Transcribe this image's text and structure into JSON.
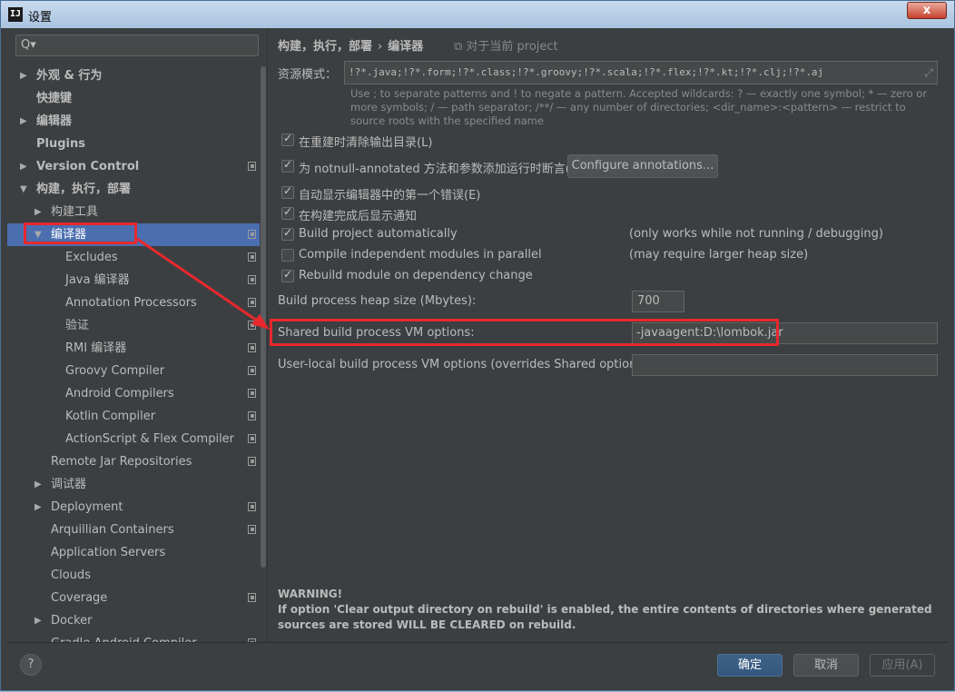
{
  "window": {
    "app_icon": "IJ",
    "title": "设置",
    "close_label": "x"
  },
  "search": {
    "placeholder": "Q▾"
  },
  "tree": [
    {
      "label": "外观 & 行为",
      "bold": true,
      "arrow": "right"
    },
    {
      "label": "快捷键",
      "bold": true
    },
    {
      "label": "编辑器",
      "bold": true,
      "arrow": "right"
    },
    {
      "label": "Plugins",
      "bold": true
    },
    {
      "label": "Version Control",
      "bold": true,
      "arrow": "right"
    },
    {
      "label": "构建，执行，部署",
      "bold": true,
      "arrow": "down"
    },
    {
      "label": "构建工具",
      "arrow": "right"
    },
    {
      "label": "编译器",
      "arrow": "down",
      "selected": true
    },
    {
      "label": "Excludes"
    },
    {
      "label": "Java 编译器"
    },
    {
      "label": "Annotation Processors"
    },
    {
      "label": "验证"
    },
    {
      "label": "RMI 编译器"
    },
    {
      "label": "Groovy Compiler"
    },
    {
      "label": "Android Compilers"
    },
    {
      "label": "Kotlin Compiler"
    },
    {
      "label": "ActionScript & Flex Compiler"
    },
    {
      "label": "Remote Jar Repositories"
    },
    {
      "label": "调试器",
      "arrow": "right"
    },
    {
      "label": "Deployment",
      "arrow": "right"
    },
    {
      "label": "Arquillian Containers"
    },
    {
      "label": "Application Servers"
    },
    {
      "label": "Clouds"
    },
    {
      "label": "Coverage"
    },
    {
      "label": "Docker",
      "arrow": "right"
    },
    {
      "label": "Gradle-Android Compiler"
    }
  ],
  "breadcrumb": {
    "parent": "构建，执行，部署",
    "separator": "›",
    "current": "编译器",
    "for_project": "⧉ 对于当前 project"
  },
  "resource": {
    "label": "资源模式：",
    "value": "!?*.java;!?*.form;!?*.class;!?*.groovy;!?*.scala;!?*.flex;!?*.kt;!?*.clj;!?*.aj",
    "hint": "Use ; to separate patterns and ! to negate a pattern. Accepted wildcards: ? — exactly one symbol; * — zero or more symbols; / — path separator; /**/ — any number of directories; <dir_name>:<pattern> — restrict to source roots with the specified name"
  },
  "options": {
    "clear_output": {
      "label": "在重建时清除输出目录(L)",
      "checked": true
    },
    "notnull": {
      "label": "为 notnull-annotated 方法和参数添加运行时断言(A)",
      "checked": true
    },
    "configure_annotations": "Configure annotations...",
    "show_first_error": {
      "label": "自动显示编辑器中的第一个错误(E)",
      "checked": true
    },
    "notify_done": {
      "label": "在构建完成后显示通知",
      "checked": true
    },
    "build_auto": {
      "label": "Build project automatically",
      "checked": true,
      "note": "(only works while not running / debugging)"
    },
    "compile_parallel": {
      "label": "Compile independent modules in parallel",
      "checked": false,
      "note": "(may require larger heap size)"
    },
    "rebuild_on_dep": {
      "label": "Rebuild module on dependency change",
      "checked": true
    }
  },
  "heap": {
    "label": "Build process heap size (Mbytes):",
    "value": "700"
  },
  "shared_vm": {
    "label": "Shared build process VM options:",
    "value": "-javaagent:D:\\lombok.jar"
  },
  "user_vm": {
    "label": "User-local build process VM options (overrides Shared options):",
    "value": ""
  },
  "warning": {
    "title": "WARNING!",
    "text": "If option 'Clear output directory on rebuild' is enabled, the entire contents of directories where generated sources are stored WILL BE CLEARED on rebuild."
  },
  "buttons": {
    "help": "?",
    "ok": "确定",
    "cancel": "取消",
    "apply": "应用(A)"
  },
  "annotation_color": "#e8282d"
}
